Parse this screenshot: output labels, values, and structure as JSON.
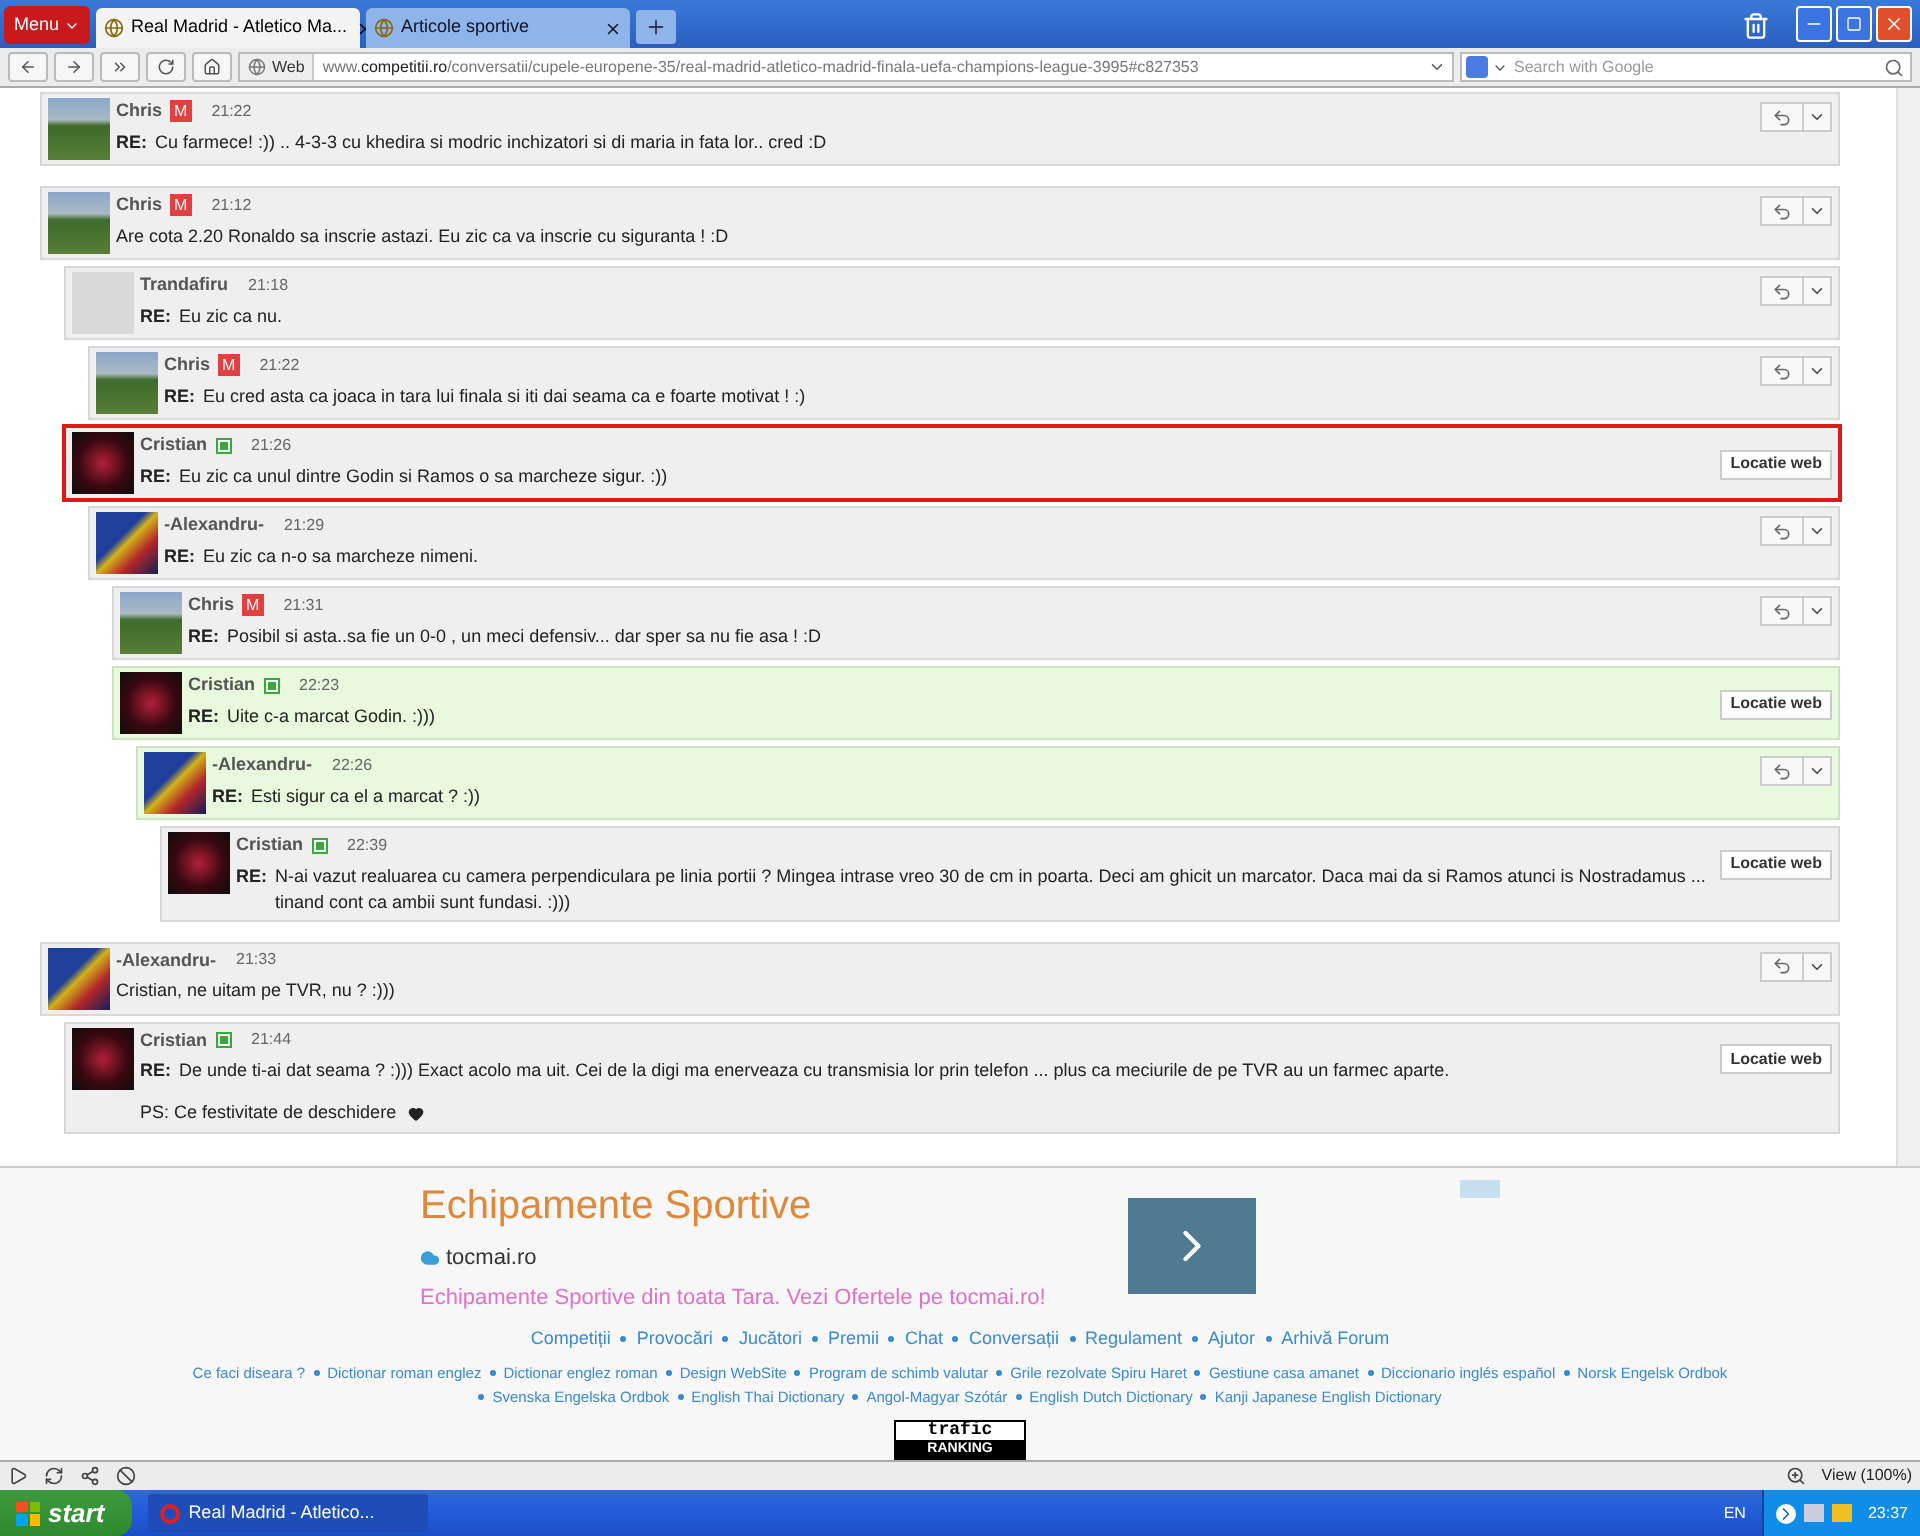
{
  "browser": {
    "menu_label": "Menu",
    "tabs": [
      {
        "title": "Real Madrid - Atletico Ma...",
        "selected": true
      },
      {
        "title": "Articole sportive",
        "selected": false
      }
    ],
    "address_badge": "Web",
    "url": "www.**competitii.ro**/conversatii/cupele-europene-35/real-madrid-atletico-madrid-finala-uefa-champions-league-3995#c827353",
    "search": {
      "placeholder": "Search with Google"
    }
  },
  "comments": [
    {
      "author": "Chris",
      "badge": {
        "kind": "red",
        "text": "M"
      },
      "avatar": {
        "kind": "field"
      },
      "time": "21:22",
      "prefix": "RE:",
      "text": "Cu farmece! :)) .. 4-3-3 cu khedira si modric inchizatori si di maria in fata lor.. cred :D",
      "action": {
        "kind": "reply"
      },
      "highlighted": false,
      "marked": false
    },
    {
      "author": "Chris",
      "badge": {
        "kind": "red",
        "text": "M"
      },
      "avatar": {
        "kind": "field"
      },
      "time": "21:12",
      "text": "Are cota 2.20 Ronaldo sa inscrie astazi. Eu zic ca va inscrie cu siguranta ! :D",
      "action": {
        "kind": "reply"
      },
      "highlighted": false,
      "marked": false,
      "children": [
        {
          "author": "Trandafiru",
          "avatar": {
            "kind": "portrait"
          },
          "time": "21:18",
          "prefix": "RE:",
          "text": "Eu zic ca nu.",
          "action": {
            "kind": "reply"
          },
          "highlighted": false,
          "marked": false,
          "children": [
            {
              "author": "Chris",
              "badge": {
                "kind": "red",
                "text": "M"
              },
              "avatar": {
                "kind": "field"
              },
              "time": "21:22",
              "prefix": "RE:",
              "text": "Eu cred asta ca joaca in tara lui finala si iti dai seama ca e foarte motivat ! :)",
              "action": {
                "kind": "reply"
              },
              "highlighted": false,
              "marked": false
            }
          ]
        },
        {
          "author": "Cristian",
          "badge": {
            "kind": "green"
          },
          "avatar": {
            "kind": "dark"
          },
          "time": "21:26",
          "prefix": "RE:",
          "text": "Eu zic ca unul dintre Godin si Ramos o sa marcheze sigur. :))",
          "action": {
            "kind": "link",
            "label": "Locatie web"
          },
          "highlighted": false,
          "marked": true,
          "children": [
            {
              "author": "-Alexandru-",
              "avatar": {
                "kind": "flag"
              },
              "time": "21:29",
              "prefix": "RE:",
              "text": "Eu zic ca n-o sa marcheze nimeni.",
              "action": {
                "kind": "reply"
              },
              "highlighted": false,
              "marked": false,
              "children": [
                {
                  "author": "Chris",
                  "badge": {
                    "kind": "red",
                    "text": "M"
                  },
                  "avatar": {
                    "kind": "field"
                  },
                  "time": "21:31",
                  "prefix": "RE:",
                  "text": "Posibil si asta..sa fie un 0-0 , un meci defensiv... dar sper sa nu fie asa ! :D",
                  "action": {
                    "kind": "reply"
                  },
                  "highlighted": false,
                  "marked": false
                },
                {
                  "author": "Cristian",
                  "badge": {
                    "kind": "green"
                  },
                  "avatar": {
                    "kind": "dark"
                  },
                  "time": "22:23",
                  "prefix": "RE:",
                  "text": "Uite c-a marcat Godin. :)))",
                  "action": {
                    "kind": "link",
                    "label": "Locatie web"
                  },
                  "highlighted": true,
                  "marked": false,
                  "children": [
                    {
                      "author": "-Alexandru-",
                      "avatar": {
                        "kind": "flag"
                      },
                      "time": "22:26",
                      "prefix": "RE:",
                      "text": "Esti sigur ca el a marcat ? :))",
                      "action": {
                        "kind": "reply"
                      },
                      "highlighted": true,
                      "marked": false,
                      "children": [
                        {
                          "author": "Cristian",
                          "badge": {
                            "kind": "green"
                          },
                          "avatar": {
                            "kind": "dark"
                          },
                          "time": "22:39",
                          "prefix": "RE:",
                          "text": "N-ai vazut realuarea cu camera perpendiculara pe linia portii ? Mingea intrase vreo 30 de cm in poarta. Deci am ghicit un marcator. Daca mai da si Ramos atunci is Nostradamus ... tinand cont ca ambii sunt fundasi. :)))",
                          "action": {
                            "kind": "link",
                            "label": "Locatie web"
                          },
                          "highlighted": false,
                          "marked": false
                        }
                      ]
                    }
                  ]
                }
              ]
            }
          ]
        }
      ]
    },
    {
      "author": "-Alexandru-",
      "avatar": {
        "kind": "flag"
      },
      "time": "21:33",
      "text": "Cristian, ne uitam pe TVR, nu ? :)))",
      "action": {
        "kind": "reply"
      },
      "highlighted": false,
      "marked": false,
      "children": [
        {
          "author": "Cristian",
          "badge": {
            "kind": "green"
          },
          "avatar": {
            "kind": "dark"
          },
          "time": "21:44",
          "prefix": "RE:",
          "text": "De unde ti-ai dat seama ? :))) Exact acolo ma uit. Cei de la digi ma enerveaza cu transmisia lor prin telefon ... plus ca meciurile de pe TVR au un farmec aparte.",
          "postscript": "PS: Ce festivitate de deschidere",
          "action": {
            "kind": "link",
            "label": "Locatie web"
          },
          "highlighted": false,
          "marked": false
        }
      ]
    }
  ],
  "ad": {
    "title": "Echipamente Sportive",
    "domain": "tocmai.ro",
    "description": "Echipamente Sportive din toata Tara. Vezi Ofertele pe tocmai.ro!"
  },
  "footer": {
    "nav": [
      "Competiții",
      "Provocări",
      "Jucători",
      "Premii",
      "Chat",
      "Conversații",
      "Regulament",
      "Ajutor",
      "Arhivă Forum"
    ],
    "links": [
      "Ce faci diseara ?",
      "Dictionar roman englez",
      "Dictionar englez roman",
      "Design WebSite",
      "Program de schimb valutar",
      "Grile rezolvate Spiru Haret",
      "Gestiune casa amanet",
      "Diccionario inglés español",
      "Norsk Engelsk Ordbok",
      "Svenska Engelska Ordbok",
      "English Thai Dictionary",
      "Angol-Magyar Szótár",
      "English Dutch Dictionary",
      "Kanji Japanese English Dictionary"
    ],
    "badge_top": "trafic",
    "badge_bottom": "RANKING"
  },
  "status_bar": {
    "zoom": "View (100%)"
  },
  "taskbar": {
    "start": "start",
    "task": "Real Madrid - Atletico...",
    "language": "EN",
    "clock": "23:37"
  }
}
